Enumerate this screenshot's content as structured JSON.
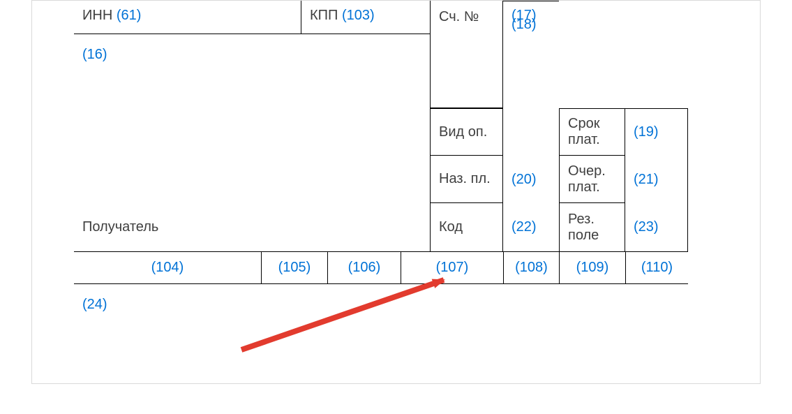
{
  "labels": {
    "inn": "ИНН",
    "kpp": "КПП",
    "acct": "Сч. №",
    "recipient": "Получатель",
    "vid_op": "Вид оп.",
    "naz_pl": "Наз. пл.",
    "kod": "Код",
    "srok_plat": "Срок плат.",
    "ocher_plat": "Очер. плат.",
    "rez_pole": "Рез. поле"
  },
  "codes": {
    "c61": "(61)",
    "c103": "(103)",
    "c16": "(16)",
    "c17": "(17)",
    "c18": "(18)",
    "c19": "(19)",
    "c20": "(20)",
    "c21": "(21)",
    "c22": "(22)",
    "c23": "(23)",
    "c24": "(24)",
    "c104": "(104)",
    "c105": "(105)",
    "c106": "(106)",
    "c107": "(107)",
    "c108": "(108)",
    "c109": "(109)",
    "c110": "(110)"
  }
}
